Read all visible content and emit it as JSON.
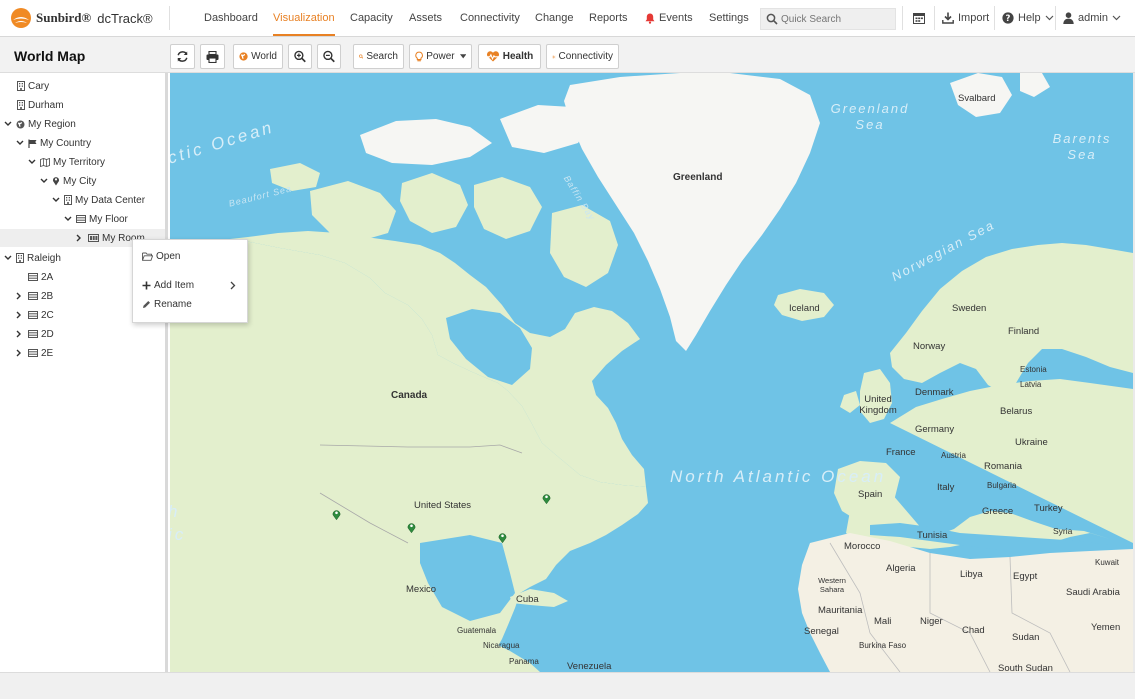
{
  "app": {
    "brand": "Sunbird®",
    "product": "dcTrack®"
  },
  "nav": {
    "items": [
      "Dashboard",
      "Visualization",
      "Capacity",
      "Assets",
      "Connectivity",
      "Change",
      "Reports",
      "Events",
      "Settings"
    ],
    "active": "Visualization"
  },
  "header": {
    "search_placeholder": "Quick Search",
    "import_label": "Import",
    "help_label": "Help",
    "user_label": "admin"
  },
  "page": {
    "title": "World Map"
  },
  "toolbar": {
    "world_label": "World",
    "search_label": "Search",
    "power_label": "Power",
    "health_label": "Health",
    "connectivity_label": "Connectivity"
  },
  "tree": {
    "nodes": [
      {
        "label": "Cary",
        "icon": "building-icon",
        "expand": ""
      },
      {
        "label": "Durham",
        "icon": "building-icon",
        "expand": ""
      },
      {
        "label": "My Region",
        "icon": "globe-icon",
        "expand": "open"
      },
      {
        "label": "My Country",
        "icon": "flag-icon",
        "expand": "open"
      },
      {
        "label": "My Territory",
        "icon": "map-icon",
        "expand": "open"
      },
      {
        "label": "My City",
        "icon": "map-marker-icon",
        "expand": "open"
      },
      {
        "label": "My Data Center",
        "icon": "building-icon",
        "expand": "open"
      },
      {
        "label": "My Floor",
        "icon": "floor-icon",
        "expand": "open"
      },
      {
        "label": "My Room",
        "icon": "room-icon",
        "expand": "closed"
      },
      {
        "label": "Raleigh",
        "icon": "building-icon",
        "expand": "open"
      },
      {
        "label": "2A",
        "icon": "floor-icon",
        "expand": ""
      },
      {
        "label": "2B",
        "icon": "floor-icon",
        "expand": "closed"
      },
      {
        "label": "2C",
        "icon": "floor-icon",
        "expand": "closed"
      },
      {
        "label": "2D",
        "icon": "floor-icon",
        "expand": "closed"
      },
      {
        "label": "2E",
        "icon": "floor-icon",
        "expand": "closed"
      }
    ]
  },
  "context_menu": {
    "open_label": "Open",
    "add_item_label": "Add Item",
    "rename_label": "Rename"
  },
  "map": {
    "countries": [
      "Greenland",
      "Svalbard",
      "Iceland",
      "Canada",
      "United States",
      "Mexico",
      "Cuba",
      "Guatemala",
      "Nicaragua",
      "Panama",
      "Venezuela",
      "Sweden",
      "Finland",
      "Norway",
      "Estonia",
      "Latvia",
      "Denmark",
      "United Kingdom",
      "Belarus",
      "Germany",
      "Ukraine",
      "France",
      "Austria",
      "Romania",
      "Bulgaria",
      "Spain",
      "Italy",
      "Greece",
      "Turkey",
      "Tunisia",
      "Syria",
      "Kuwait",
      "Morocco",
      "Algeria",
      "Libya",
      "Egypt",
      "Saudi Arabia",
      "Western Sahara",
      "Mauritania",
      "Mali",
      "Niger",
      "Chad",
      "Sudan",
      "Yemen",
      "Senegal",
      "Burkina Faso",
      "South Sudan"
    ],
    "water": {
      "north_atlantic": "North Atlantic Ocean",
      "arctic_fragment": "ctic Ocean",
      "greenland_sea": "Greenland Sea",
      "barents_sea": "Barents Sea",
      "norwegian_sea": "Norwegian Sea",
      "beaufort_sea": "Beaufort Sea",
      "baffin_bay": "Baffin Bay",
      "pacific_fragment_1": "h",
      "pacific_fragment_2": "ic"
    },
    "markers": 4,
    "colors": {
      "water": "#6fc3e6",
      "land": "#e3efcd",
      "ice": "#f6f6f3",
      "accent": "#e88124",
      "marker": "#2e8b3e"
    }
  }
}
